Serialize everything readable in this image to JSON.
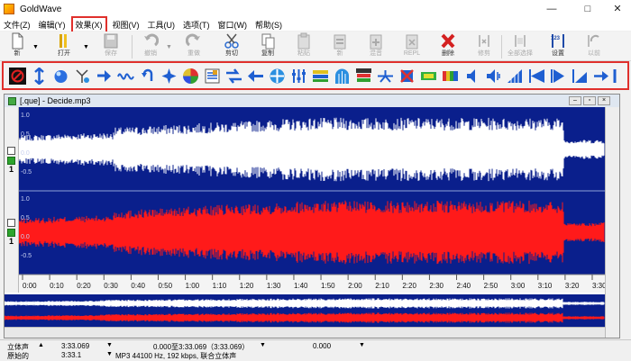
{
  "window": {
    "title": "GoldWave",
    "minimize": "—",
    "maximize": "□",
    "close": "✕"
  },
  "menu": [
    "文件(Z)",
    "编辑(Y)",
    "效果(X)",
    "视图(V)",
    "工具(U)",
    "选项(T)",
    "窗口(W)",
    "帮助(S)"
  ],
  "menu_highlight": "效果(X)",
  "toolbar": {
    "new": "新",
    "open": "打开",
    "save": "保存",
    "undo": "撤销",
    "redo": "重做",
    "cut": "剪切",
    "copy": "复制",
    "paste": "粘贴",
    "paste_new": "新",
    "mix": "混音",
    "replace": "REPL",
    "delete": "删除",
    "trim": "修剪",
    "select_all": "全部选择",
    "set": "设置",
    "set_badge": "123",
    "previous": "以前"
  },
  "effects_toolbar": {
    "icons": [
      "doppler-icon",
      "auto-gain-icon",
      "bass-boost-icon",
      "compressor-icon",
      "delay-icon",
      "dynamics-icon",
      "echo-icon",
      "equalizer-icon",
      "fade-in-icon",
      "fade-out-icon",
      "filter-icon",
      "flanger-icon",
      "invert-icon",
      "mechanize-icon",
      "noise-reduction-icon",
      "offset-icon",
      "pan-icon",
      "pitch-icon",
      "reverb-icon",
      "reverse-icon",
      "silence-icon",
      "smoother-icon",
      "spatial-icon",
      "time-warp-icon",
      "volume-icon",
      "volume-shaper-icon",
      "match-volume-icon",
      "maximize-volume-icon",
      "volume-change-icon",
      "fade-icon"
    ]
  },
  "document": {
    "title": "[.que]  - Decide.mp3"
  },
  "channels": [
    {
      "number": "1",
      "scale": [
        "1.0",
        "0.5",
        "0.0",
        "-0.5"
      ],
      "wave_color": "#ffffff"
    },
    {
      "number": "1",
      "scale": [
        "1.0",
        "0.5",
        "0.0",
        "-0.5"
      ],
      "wave_color": "#ff1a1a"
    }
  ],
  "timeline": [
    "0:00",
    "0:10",
    "0:20",
    "0:30",
    "0:40",
    "0:50",
    "1:00",
    "1:10",
    "1:20",
    "1:30",
    "1:40",
    "1:50",
    "2:00",
    "2:10",
    "2:20",
    "2:30",
    "2:40",
    "2:50",
    "3:00",
    "3:10",
    "3:20",
    "3:30"
  ],
  "colors": {
    "wave_bg": "#0a1f8c",
    "wave_upper": "#ffffff",
    "wave_lower": "#ff1a1a",
    "highlight": "#e0302c",
    "selection": "#ffd400"
  },
  "status": {
    "row1": {
      "mode": "立体声",
      "length": "3:33.069",
      "selection": "0.000至3:33.069（3:33.069）",
      "position": "0.000"
    },
    "row2": {
      "mode": "原始的",
      "length": "3:33.1",
      "format": "MP3 44100 Hz, 192 kbps, 联合立体声"
    }
  }
}
